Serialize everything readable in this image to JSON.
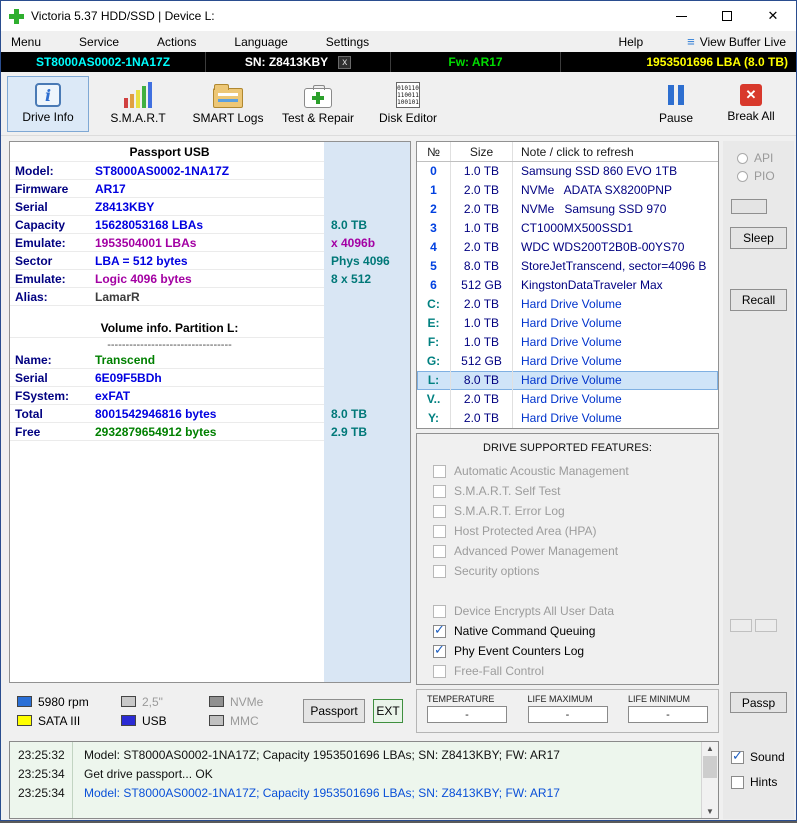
{
  "window": {
    "title": "Victoria 5.37 HDD/SSD | Device L:",
    "close_glyph": "✕"
  },
  "menubar": {
    "items": [
      "Menu",
      "Service",
      "Actions",
      "Language",
      "Settings"
    ],
    "help": "Help",
    "view_buffer": "View Buffer Live",
    "buffer_icon": "≡"
  },
  "device_bar": {
    "model": "ST8000AS0002-1NA17Z",
    "serial": "SN: Z8413KBY",
    "close": "x",
    "firmware": "Fw: AR17",
    "lba": "1953501696 LBA (8.0 TB)"
  },
  "toolbar": {
    "drive_info": "Drive Info",
    "smart": "S.M.A.R.T",
    "smart_logs": "SMART Logs",
    "test_repair": "Test & Repair",
    "disk_editor": "Disk Editor",
    "pause": "Pause",
    "break_all": "Break All"
  },
  "icons": {
    "info": "i",
    "binary": [
      "010110",
      "110011",
      "100101"
    ]
  },
  "passport": {
    "title": "Passport USB",
    "rows": [
      {
        "label": "Model:",
        "value": "ST8000AS0002-1NA17Z",
        "vcls": "blue",
        "extra": "",
        "ecls": ""
      },
      {
        "label": "Firmware",
        "value": "AR17",
        "vcls": "blue",
        "extra": "",
        "ecls": ""
      },
      {
        "label": "Serial",
        "value": "Z8413KBY",
        "vcls": "blue",
        "extra": "",
        "ecls": ""
      },
      {
        "label": "Capacity",
        "value": "15628053168 LBAs",
        "vcls": "blue",
        "extra": "8.0 TB",
        "ecls": "teal"
      },
      {
        "label": "Emulate:",
        "value": "1953504001 LBAs",
        "vcls": "purple",
        "extra": "x 4096b",
        "ecls": "purple"
      },
      {
        "label": "Sector",
        "value": "LBA = 512 bytes",
        "vcls": "blue",
        "extra": "Phys 4096",
        "ecls": "teal"
      },
      {
        "label": "Emulate:",
        "value": "Logic 4096 bytes",
        "vcls": "purple",
        "extra": "8 x 512",
        "ecls": "teal"
      },
      {
        "label": "Alias:",
        "value": "LamarR",
        "vcls": "dark",
        "extra": "",
        "ecls": ""
      }
    ],
    "volume_title": "Volume info. Partition L:",
    "divider": "----------------------------------",
    "volume_rows": [
      {
        "label": "Name:",
        "value": "Transcend",
        "vcls": "green",
        "extra": "",
        "ecls": ""
      },
      {
        "label": "Serial",
        "value": "6E09F5BDh",
        "vcls": "blue",
        "extra": "",
        "ecls": ""
      },
      {
        "label": "FSystem:",
        "value": "exFAT",
        "vcls": "blue",
        "extra": "",
        "ecls": ""
      },
      {
        "label": "Total",
        "value": "8001542946816 bytes",
        "vcls": "blue",
        "extra": "8.0 TB",
        "ecls": "teal"
      },
      {
        "label": "Free",
        "value": "2932879654912 bytes",
        "vcls": "green",
        "extra": "2.9 TB",
        "ecls": "teal"
      }
    ]
  },
  "drive_table": {
    "headers": {
      "no": "№",
      "size": "Size",
      "note": "Note / click to refresh"
    },
    "rows": [
      {
        "no": "0",
        "size": "1.0 TB",
        "note": "Samsung SSD 860 EVO 1TB",
        "cls": ""
      },
      {
        "no": "1",
        "size": "2.0 TB",
        "note": "NVMe   ADATA SX8200PNP",
        "cls": ""
      },
      {
        "no": "2",
        "size": "2.0 TB",
        "note": "NVMe   Samsung SSD 970",
        "cls": ""
      },
      {
        "no": "3",
        "size": "1.0 TB",
        "note": "CT1000MX500SSD1",
        "cls": ""
      },
      {
        "no": "4",
        "size": "2.0 TB",
        "note": "WDC WDS200T2B0B-00YS70",
        "cls": ""
      },
      {
        "no": "5",
        "size": "8.0 TB",
        "note": "StoreJetTranscend, sector=4096 B",
        "cls": ""
      },
      {
        "no": "6",
        "size": "512 GB",
        "note": "KingstonDataTraveler Max",
        "cls": ""
      },
      {
        "no": "C:",
        "size": "2.0 TB",
        "note": "Hard Drive Volume",
        "cls": "letter"
      },
      {
        "no": "E:",
        "size": "1.0 TB",
        "note": "Hard Drive Volume",
        "cls": "letter"
      },
      {
        "no": "F:",
        "size": "1.0 TB",
        "note": "Hard Drive Volume",
        "cls": "letter"
      },
      {
        "no": "G:",
        "size": "512 GB",
        "note": "Hard Drive Volume",
        "cls": "letter"
      },
      {
        "no": "L:",
        "size": "8.0 TB",
        "note": "Hard Drive Volume",
        "cls": "letter selected"
      },
      {
        "no": "V..",
        "size": "2.0 TB",
        "note": "Hard Drive Volume",
        "cls": "letter"
      },
      {
        "no": "Y:",
        "size": "2.0 TB",
        "note": "Hard Drive Volume",
        "cls": "letter"
      }
    ]
  },
  "features": {
    "title": "DRIVE SUPPORTED FEATURES:",
    "items": [
      {
        "label": "Automatic Acoustic Management",
        "cls": "disabled"
      },
      {
        "label": "S.M.A.R.T. Self Test",
        "cls": "disabled"
      },
      {
        "label": "S.M.A.R.T. Error Log",
        "cls": "disabled"
      },
      {
        "label": "Host Protected Area (HPA)",
        "cls": "disabled"
      },
      {
        "label": "Advanced Power Management",
        "cls": "disabled"
      },
      {
        "label": "Security options",
        "cls": "disabled gap-after"
      },
      {
        "label": "Device Encrypts All User Data",
        "cls": "disabled"
      },
      {
        "label": "Native Command Queuing",
        "cls": "checked"
      },
      {
        "label": "Phy Event Counters Log",
        "cls": "checked"
      },
      {
        "label": "Free-Fall Control",
        "cls": "disabled"
      }
    ]
  },
  "legend": {
    "items": [
      {
        "label": "5980 rpm",
        "color": "#2a6fd6",
        "cls": ""
      },
      {
        "label": "2,5\"",
        "color": "#c8c8c8",
        "cls": "muted"
      },
      {
        "label": "NVMe",
        "color": "#909090",
        "cls": "muted"
      },
      {
        "label": "SATA III",
        "color": "#ffff00",
        "cls": ""
      },
      {
        "label": "USB",
        "color": "#2b2bd4",
        "cls": ""
      },
      {
        "label": "MMC",
        "color": "#c0c0c0",
        "cls": "muted"
      }
    ],
    "passport_button": "Passport",
    "ext_button": "EXT"
  },
  "gauges": {
    "items": [
      {
        "label": "TEMPERATURE",
        "value": "-"
      },
      {
        "label": "LIFE MAXIMUM",
        "value": "-"
      },
      {
        "label": "LIFE MINIMUM",
        "value": "-"
      }
    ]
  },
  "sidebar": {
    "api": "API",
    "pio": "PIO",
    "sleep": "Sleep",
    "recall": "Recall",
    "passp": "Passp",
    "sound": "Sound",
    "hints": "Hints"
  },
  "log": {
    "rows": [
      {
        "time": "23:25:32",
        "text": "Model: ST8000AS0002-1NA17Z; Capacity 1953501696 LBAs; SN: Z8413KBY; FW: AR17",
        "cls": ""
      },
      {
        "time": "23:25:34",
        "text": "Get drive passport... OK",
        "cls": ""
      },
      {
        "time": "23:25:34",
        "text": "Model: ST8000AS0002-1NA17Z; Capacity 1953501696 LBAs; SN: Z8413KBY; FW: AR17",
        "cls": "blue"
      }
    ]
  },
  "colors": {
    "model_cyan": "#00ffff",
    "fw_green": "#00dd00",
    "lba_yellow": "#ffff00",
    "value_blue": "#0000e0",
    "value_purple": "#a300a3",
    "value_teal": "#007878",
    "value_green": "#008000",
    "label_navy": "#000080",
    "selected_row": "#cfe4f8"
  }
}
